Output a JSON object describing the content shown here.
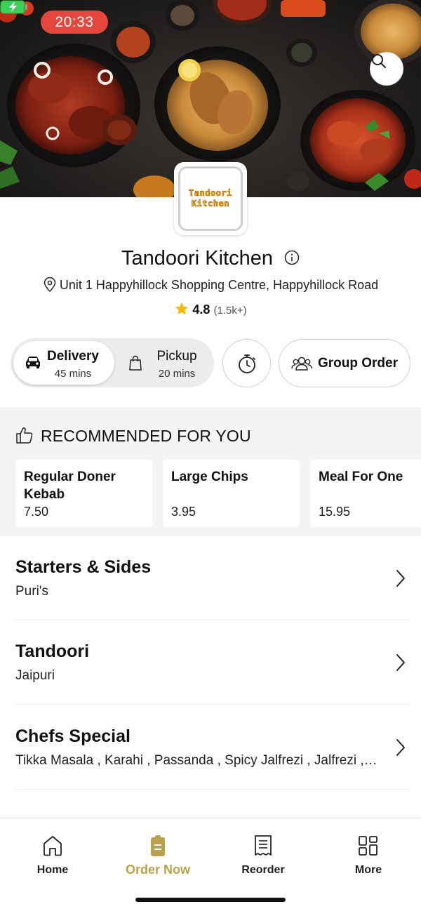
{
  "status": {
    "time": "20:33",
    "battery_icon": "battery-charging-icon"
  },
  "hero": {
    "search_icon": "search-icon"
  },
  "logo": {
    "line1": "Tandoori",
    "line2": "Kitchen"
  },
  "restaurant": {
    "name": "Tandoori Kitchen",
    "address": "Unit 1 Happyhillock Shopping Centre, Happyhillock Road",
    "rating": "4.8",
    "rating_count": "(1.5k+)"
  },
  "order_modes": {
    "delivery": {
      "label": "Delivery",
      "time": "45 mins",
      "selected": true
    },
    "pickup": {
      "label": "Pickup",
      "time": "20 mins",
      "selected": false
    },
    "group_order_label": "Group Order"
  },
  "recommended": {
    "title": "RECOMMENDED FOR YOU",
    "items": [
      {
        "name": "Regular Doner Kebab",
        "price": "7.50"
      },
      {
        "name": "Large Chips",
        "price": "3.95"
      },
      {
        "name": "Meal For One",
        "price": "15.95"
      }
    ]
  },
  "categories": [
    {
      "name": "Starters & Sides",
      "subtitle": "Puri's"
    },
    {
      "name": "Tandoori",
      "subtitle": "Jaipuri"
    },
    {
      "name": "Chefs Special",
      "subtitle": "Tikka Masala , Karahi , Passanda , Spicy Jalfrezi , Jalfrezi , Bhuna"
    }
  ],
  "tabbar": {
    "items": [
      {
        "label": "Home",
        "icon": "home-icon"
      },
      {
        "label": "Order Now",
        "icon": "order-icon",
        "active": true
      },
      {
        "label": "Reorder",
        "icon": "receipt-icon"
      },
      {
        "label": "More",
        "icon": "grid-icon"
      }
    ]
  },
  "colors": {
    "accent": "#b9a24b",
    "time_pill": "#e4473b",
    "star": "#f5b800"
  }
}
